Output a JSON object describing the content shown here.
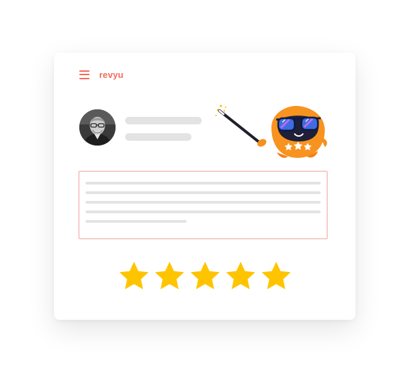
{
  "brand": {
    "name": "revyu",
    "accent_color": "#f26b5b"
  },
  "icons": {
    "menu": "hamburger-menu-icon",
    "avatar": "user-avatar-photo",
    "mascot": "orange-mascot-with-sunglasses-and-magic-wand",
    "star": "star-icon"
  },
  "rating": {
    "value": 5,
    "max": 5,
    "star_color": "#ffc400"
  },
  "review_box": {
    "border_color": "#f0a29a",
    "line_count": 5
  }
}
